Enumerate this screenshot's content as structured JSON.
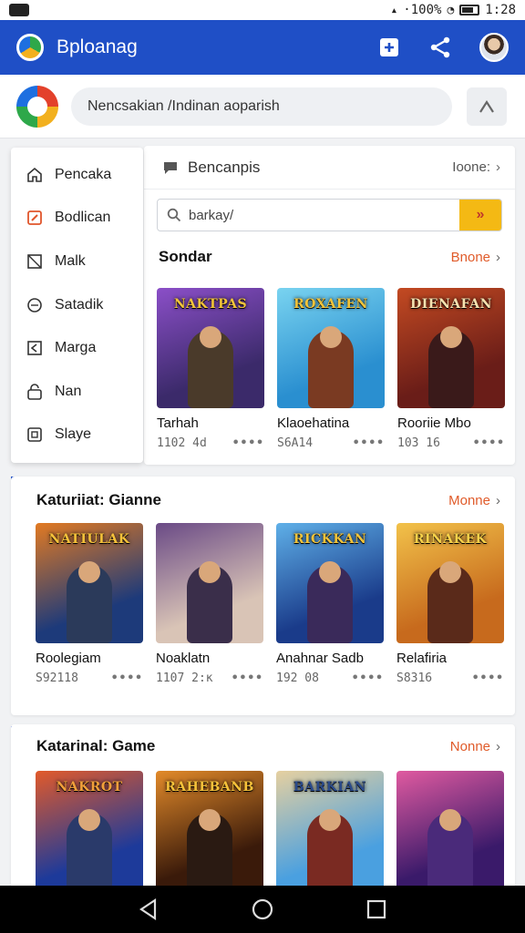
{
  "status_bar": {
    "time": "1:28",
    "center_text": "·100%"
  },
  "app_bar": {
    "title": "Bploanag"
  },
  "search": {
    "placeholder": "Nencsakian /Indinan aoparish"
  },
  "drawer": {
    "items": [
      {
        "label": "Pencaka",
        "icon": "home-icon"
      },
      {
        "label": "Bodlican",
        "icon": "edit-icon",
        "accent": "#e0552b"
      },
      {
        "label": "Malk",
        "icon": "square-icon"
      },
      {
        "label": "Satadik",
        "icon": "circle-icon"
      },
      {
        "label": "Marga",
        "icon": "bookmark-icon"
      },
      {
        "label": "Nan",
        "icon": "lock-icon"
      },
      {
        "label": "Slaye",
        "icon": "window-icon"
      }
    ]
  },
  "panel": {
    "title": "Bencanpis",
    "more": "Ioone:",
    "search_value": "barkay/"
  },
  "section1": {
    "title": "Sondar",
    "more": "Bnone",
    "tiles": [
      {
        "art_title": "NAKTPAS",
        "name": "Tarhah",
        "meta": "1102 4d",
        "bg": "#3b2a6a",
        "bg2": "#8b4fc8",
        "fig": "#4a3a2a",
        "tc": "#f2c43a"
      },
      {
        "art_title": "ROXAFEN",
        "name": "Klaoehatina",
        "meta": "S6A14",
        "bg": "#2a8fd0",
        "bg2": "#79d3f0",
        "fig": "#7a3a22",
        "tc": "#f2c43a"
      },
      {
        "art_title": "DIENAFAN",
        "name": "Rooriie Mbo",
        "meta": "103 16",
        "bg": "#6a1d18",
        "bg2": "#c34a22",
        "fig": "#3a1a1a",
        "tc": "#f6e2b0"
      }
    ]
  },
  "section2": {
    "title": "Katuriiat: Gianne",
    "more": "Monne",
    "tiles": [
      {
        "art_title": "NATIULAK",
        "name": "Roolegiam",
        "meta": "S92118",
        "bg": "#1d3a7a",
        "bg2": "#e27a22",
        "fig": "#2b3a5a",
        "tc": "#f6c23a"
      },
      {
        "art_title": "",
        "name": "Noaklatn",
        "meta": "1107 2:ĸ",
        "bg": "#d9c4b6",
        "bg2": "#6a4a86",
        "fig": "#3a2e4a",
        "tc": "#ffffff"
      },
      {
        "art_title": "RICKKAN",
        "name": "Anahnar Sadb",
        "meta": "192 08",
        "bg": "#1a3b8a",
        "bg2": "#5fb0e8",
        "fig": "#3a2a5a",
        "tc": "#f2c43a"
      },
      {
        "art_title": "RINAKEK",
        "name": "Relafiria",
        "meta": "S8316",
        "bg": "#c76a1d",
        "bg2": "#f2c24a",
        "fig": "#5a2a1a",
        "tc": "#f7d24a"
      }
    ]
  },
  "section3": {
    "title": "Katarinal: Game",
    "more": "Nonne",
    "tiles": [
      {
        "art_title": "NAKROT",
        "bg": "#1d3a9a",
        "bg2": "#e25a2a",
        "fig": "#2a3a6a",
        "tc": "#f2a03a"
      },
      {
        "art_title": "RAHEBANB",
        "bg": "#3a1a0a",
        "bg2": "#e28a2a",
        "fig": "#2a1a12",
        "tc": "#f6c23a"
      },
      {
        "art_title": "BARKIAN",
        "bg": "#4aa0e0",
        "bg2": "#e6d0a0",
        "fig": "#7a2a22",
        "tc": "#2a4a8a"
      },
      {
        "art_title": "",
        "bg": "#3a1a6a",
        "bg2": "#e05aa0",
        "fig": "#4a2a7a",
        "tc": "#ffffff"
      }
    ]
  }
}
